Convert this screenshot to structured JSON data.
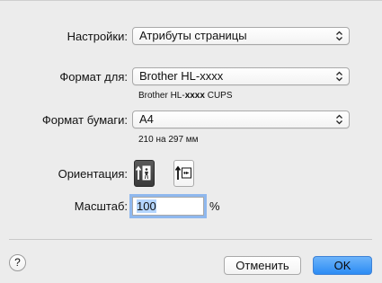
{
  "dialog": {
    "settings": {
      "label": "Настройки:",
      "value": "Атрибуты страницы"
    },
    "format_for": {
      "label": "Формат для:",
      "value": "Brother HL-xxxx",
      "subtext_prefix": "Brother HL-",
      "subtext_bold": "xxxx",
      "subtext_suffix": " CUPS"
    },
    "paper_size": {
      "label": "Формат бумаги:",
      "value": "A4",
      "subtext": "210 на 297 мм"
    },
    "orientation": {
      "label": "Ориентация:",
      "selected": "portrait"
    },
    "scale": {
      "label": "Масштаб:",
      "value": "100",
      "unit": "%"
    },
    "buttons": {
      "help": "?",
      "cancel": "Отменить",
      "ok": "OK"
    }
  },
  "colors": {
    "accent": "#2c8cf4",
    "focus_ring": "#8fb8ee",
    "background": "#ececec"
  }
}
